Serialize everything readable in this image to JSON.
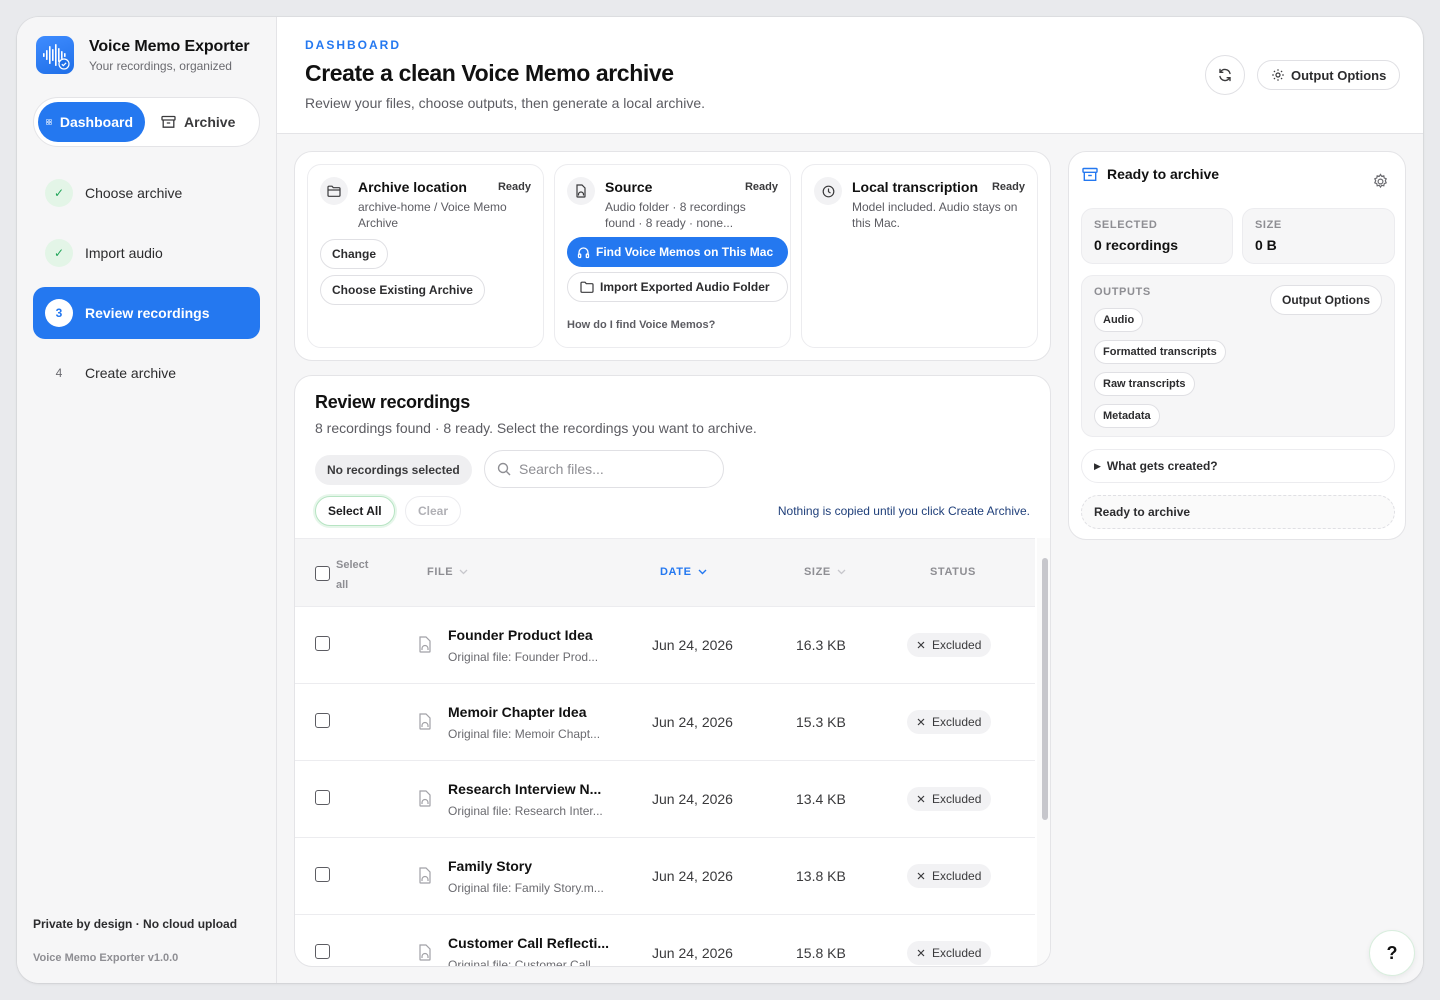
{
  "app": {
    "title": "Voice Memo Exporter",
    "subtitle": "Your recordings, organized",
    "version": "Voice Memo Exporter v1.0.0",
    "privacy": "Private by design · No cloud upload",
    "accent": "#2478f0"
  },
  "nav": {
    "dashboard_label": "Dashboard",
    "archive_label": "Archive",
    "steps": [
      {
        "label": "Choose archive",
        "badge": "✓",
        "state": "done"
      },
      {
        "label": "Import audio",
        "badge": "✓",
        "state": "done"
      },
      {
        "label": "Review recordings",
        "badge": "3",
        "state": "active"
      },
      {
        "label": "Create archive",
        "badge": "4",
        "state": "pending"
      }
    ]
  },
  "header": {
    "eyebrow": "DASHBOARD",
    "title": "Create a clean Voice Memo archive",
    "subtitle": "Review your files, choose outputs, then generate a local archive.",
    "output_options_label": "Output Options"
  },
  "setup": {
    "archive": {
      "title": "Archive location",
      "status": "Ready",
      "desc": "archive-home / Voice Memo Archive",
      "change_label": "Change",
      "choose_existing_label": "Choose Existing Archive"
    },
    "source": {
      "title": "Source",
      "status": "Ready",
      "desc": "Audio folder · 8 recordings found · 8 ready · none...",
      "find_label": "Find Voice Memos on This Mac",
      "import_label": "Import Exported Audio Folder",
      "help_label": "How do I find Voice Memos?"
    },
    "transcription": {
      "title": "Local transcription",
      "status": "Ready",
      "desc": "Model included. Audio stays on this Mac."
    }
  },
  "review": {
    "title": "Review recordings",
    "subtitle": "8 recordings found · 8 ready. Select the recordings you want to archive.",
    "selection_chip": "No recordings selected",
    "search_placeholder": "Search files...",
    "select_all_label": "Select All",
    "clear_label": "Clear",
    "note": "Nothing is copied until you click Create Archive.",
    "columns": {
      "select_all": "Select all",
      "file": "FILE",
      "date": "DATE",
      "size": "SIZE",
      "status": "STATUS"
    },
    "rows": [
      {
        "name": "Founder Product Idea",
        "original": "Original file: Founder Prod...",
        "date": "Jun 24, 2026",
        "size": "16.3 KB",
        "status": "Excluded"
      },
      {
        "name": "Memoir Chapter Idea",
        "original": "Original file: Memoir Chapt...",
        "date": "Jun 24, 2026",
        "size": "15.3 KB",
        "status": "Excluded"
      },
      {
        "name": "Research Interview N...",
        "original": "Original file: Research Inter...",
        "date": "Jun 24, 2026",
        "size": "13.4 KB",
        "status": "Excluded"
      },
      {
        "name": "Family Story",
        "original": "Original file: Family Story.m...",
        "date": "Jun 24, 2026",
        "size": "13.8 KB",
        "status": "Excluded"
      },
      {
        "name": "Customer Call Reflecti...",
        "original": "Original file: Customer Call...",
        "date": "Jun 24, 2026",
        "size": "15.8 KB",
        "status": "Excluded"
      }
    ]
  },
  "summary": {
    "title": "Ready to archive",
    "selected_label": "SELECTED",
    "selected_value": "0 recordings",
    "size_label": "SIZE",
    "size_value": "0 B",
    "outputs_label": "OUTPUTS",
    "output_options_label": "Output Options",
    "outputs": [
      "Audio",
      "Formatted transcripts",
      "Raw transcripts",
      "Metadata"
    ],
    "details_label": "What gets created?",
    "status_label": "Ready to archive"
  },
  "help_label": "?"
}
